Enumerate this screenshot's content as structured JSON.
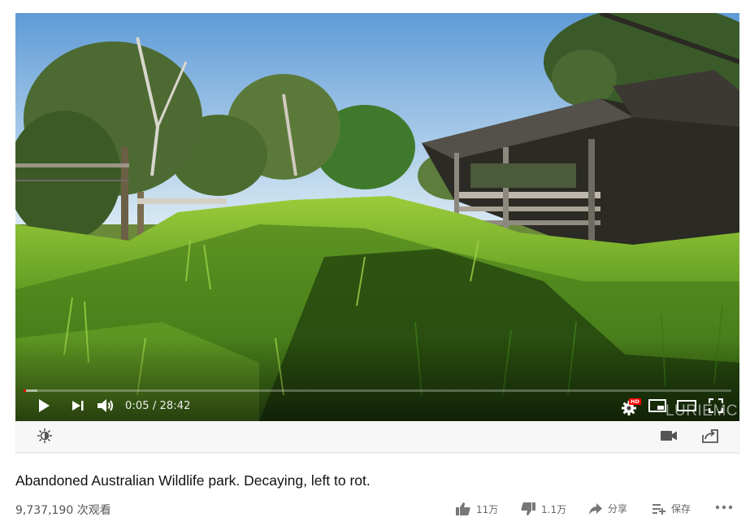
{
  "player": {
    "current_time": "0:05",
    "time_separator": "/",
    "duration": "28:42",
    "time_display": "0:05 / 28:42",
    "progress_fraction": 0.003,
    "buffered_fraction": 0.02,
    "watermark": "LURIEMC",
    "hd_badge": "HD",
    "progress_color": "#ff0000"
  },
  "video": {
    "title": "Abandoned Australian Wildlife park. Decaying, left to rot.",
    "views": "9,737,190 次观看"
  },
  "actions": {
    "like_count": "11万",
    "dislike_count": "1.1万",
    "share_label": "分享",
    "save_label": "保存"
  },
  "icons": {
    "play": "play-icon",
    "next": "next-icon",
    "volume": "volume-icon",
    "settings": "gear-icon",
    "miniplayer": "miniplayer-icon",
    "theater": "theater-icon",
    "fullscreen": "fullscreen-icon",
    "brightness": "brightness-icon",
    "camera": "video-camera-icon",
    "share_out": "share-out-icon",
    "like": "thumbs-up-icon",
    "dislike": "thumbs-down-icon",
    "share": "share-arrow-icon",
    "save": "playlist-add-icon",
    "more": "more-icon"
  }
}
